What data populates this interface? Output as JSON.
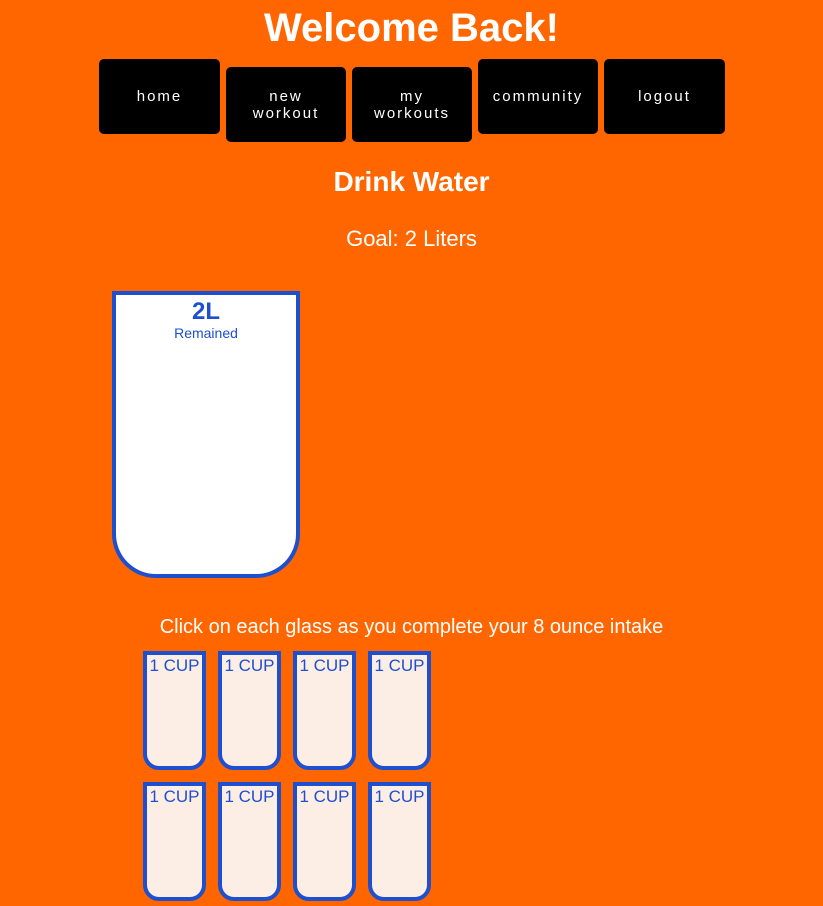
{
  "header": {
    "title": "Welcome Back!"
  },
  "nav": {
    "items": [
      {
        "line1": "home",
        "line2": ""
      },
      {
        "line1": "new",
        "line2": "workout"
      },
      {
        "line1": "my",
        "line2": "workouts"
      },
      {
        "line1": "community",
        "line2": ""
      },
      {
        "line1": "logout",
        "line2": ""
      }
    ]
  },
  "tracker": {
    "title": "Drink Water",
    "goal": "Goal: 2 Liters",
    "big_cup": {
      "liters": "2L",
      "remained": "Remained",
      "fill_fraction": 0
    },
    "instruction": "Click on each glass as you complete your 8 ounce intake",
    "cups": [
      {
        "label": "1 CUP",
        "filled": false
      },
      {
        "label": "1 CUP",
        "filled": false
      },
      {
        "label": "1 CUP",
        "filled": false
      },
      {
        "label": "1 CUP",
        "filled": false
      },
      {
        "label": "1 CUP",
        "filled": false
      },
      {
        "label": "1 CUP",
        "filled": false
      },
      {
        "label": "1 CUP",
        "filled": false
      },
      {
        "label": "1 CUP",
        "filled": false
      }
    ]
  },
  "colors": {
    "background": "#ff6600",
    "nav_button": "#000000",
    "cup_border": "#1e4fce",
    "big_cup_fill": "#ffffff",
    "small_cup_fill": "#fdeee5"
  }
}
